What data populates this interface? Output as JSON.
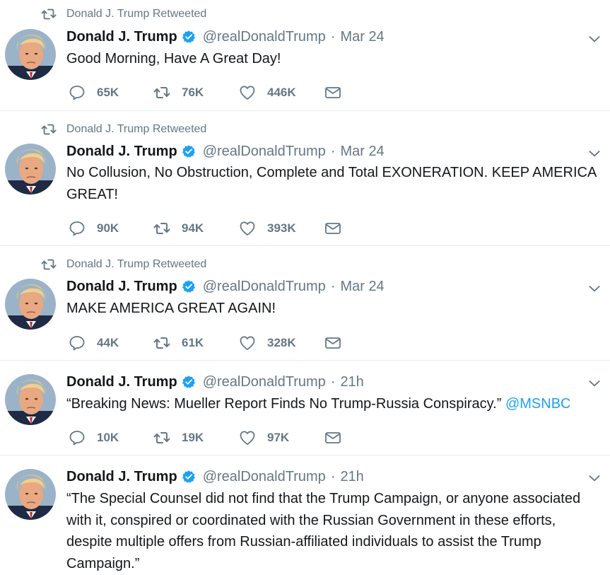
{
  "tweets": [
    {
      "retweeted_by": "Donald J. Trump Retweeted",
      "name": "Donald J. Trump",
      "handle": "@realDonaldTrump",
      "separator": "·",
      "time": "Mar 24",
      "text": "Good Morning, Have A Great Day!",
      "replies": "65K",
      "retweets": "76K",
      "likes": "446K"
    },
    {
      "retweeted_by": "Donald J. Trump Retweeted",
      "name": "Donald J. Trump",
      "handle": "@realDonaldTrump",
      "separator": "·",
      "time": "Mar 24",
      "text": "No Collusion, No Obstruction, Complete and Total EXONERATION. KEEP AMERICA GREAT!",
      "replies": "90K",
      "retweets": "94K",
      "likes": "393K"
    },
    {
      "retweeted_by": "Donald J. Trump Retweeted",
      "name": "Donald J. Trump",
      "handle": "@realDonaldTrump",
      "separator": "·",
      "time": "Mar 24",
      "text": "MAKE AMERICA GREAT AGAIN!",
      "replies": "44K",
      "retweets": "61K",
      "likes": "328K"
    },
    {
      "name": "Donald J. Trump",
      "handle": "@realDonaldTrump",
      "separator": "·",
      "time": "21h",
      "text": "“Breaking News: Mueller Report Finds No Trump-Russia Conspiracy.”",
      "mention": "@MSNBC",
      "replies": "10K",
      "retweets": "19K",
      "likes": "97K"
    },
    {
      "name": "Donald J. Trump",
      "handle": "@realDonaldTrump",
      "separator": "·",
      "time": "21h",
      "text_lines": [
        "“The Special Counsel did not find that the Trump Campaign, or anyone associated",
        "with it, conspired or coordinated with the Russian Government in these efforts,",
        "despite multiple offers from Russian-affiliated individuals to assist the Trump",
        "Campaign.”"
      ]
    }
  ],
  "colors": {
    "accent": "#1da1f2",
    "text_primary": "#14171a",
    "text_secondary": "#657786",
    "divider": "#e6ecf0"
  },
  "icons": {
    "retweet": "retweet-icon",
    "reply": "reply-icon",
    "like": "heart-icon",
    "message": "envelope-icon",
    "verified": "verified-badge-icon",
    "caret": "chevron-down-icon"
  }
}
